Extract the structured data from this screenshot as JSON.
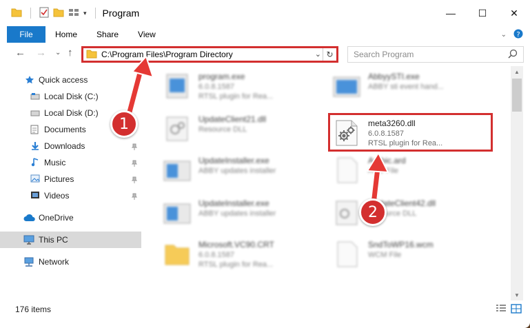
{
  "window": {
    "title": "Program"
  },
  "ribbon": {
    "tabs": [
      "File",
      "Home",
      "Share",
      "View"
    ]
  },
  "address": {
    "path": "C:\\Program Files\\Program Directory"
  },
  "search": {
    "placeholder": "Search Program"
  },
  "sidebar": {
    "items": [
      {
        "label": "Quick access",
        "icon": "star-icon"
      },
      {
        "label": "Local Disk (C:)",
        "icon": "drive-icon"
      },
      {
        "label": "Local Disk (D:)",
        "icon": "drive-icon"
      },
      {
        "label": "Documents",
        "icon": "documents-icon"
      },
      {
        "label": "Downloads",
        "icon": "download-icon"
      },
      {
        "label": "Music",
        "icon": "music-icon"
      },
      {
        "label": "Pictures",
        "icon": "pictures-icon"
      },
      {
        "label": "Videos",
        "icon": "videos-icon"
      },
      {
        "label": "OneDrive",
        "icon": "cloud-icon"
      },
      {
        "label": "This PC",
        "icon": "computer-icon"
      },
      {
        "label": "Network",
        "icon": "network-icon"
      }
    ]
  },
  "files": [
    {
      "name": "program.exe",
      "line1": "6.0.8.1587",
      "line2": "RTSL plugin for Rea..."
    },
    {
      "name": "AbbyySTI.exe",
      "line1": "ABBY sti event hand...",
      "line2": ""
    },
    {
      "name": "UpdateClient21.dll",
      "line1": "Resource DLL",
      "line2": ""
    },
    {
      "name": "meta3260.dll",
      "line1": "6.0.8.1587",
      "line2": "RTSL plugin for Rea..."
    },
    {
      "name": "UpdateInstaller.exe",
      "line1": "ABBY updates installer",
      "line2": ""
    },
    {
      "name": "Arabic.ard",
      "line1": "ARD File",
      "line2": ""
    },
    {
      "name": "UpdateInstaller.exe",
      "line1": "ABBY updates installer",
      "line2": ""
    },
    {
      "name": "UpdateClient42.dll",
      "line1": "Resource DLL",
      "line2": ""
    },
    {
      "name": "Microsoft.VC90.CRT",
      "line1": "6.0.8.1587",
      "line2": "RTSL plugin for Rea..."
    },
    {
      "name": "SndToWP16.wcm",
      "line1": "WCM File",
      "line2": ""
    }
  ],
  "status": {
    "item_count": "176 items"
  },
  "callouts": {
    "one": "1",
    "two": "2"
  },
  "colors": {
    "accent": "#1979ca",
    "highlight": "#d32f2f"
  }
}
